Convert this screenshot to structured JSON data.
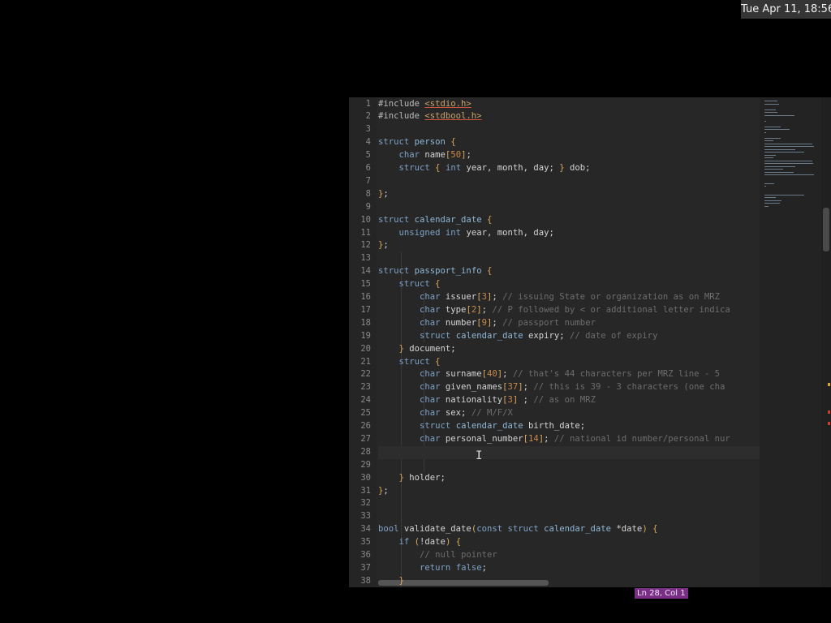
{
  "topbar": {
    "clock": "Tue Apr 11, 18:56"
  },
  "status": {
    "cursor_position": "Ln 28, Col 1"
  },
  "editor": {
    "current_line": 28,
    "lines": [
      {
        "n": "1",
        "t": [
          [
            "pp",
            "#include "
          ],
          [
            "inc",
            "<stdio.h>"
          ]
        ]
      },
      {
        "n": "2",
        "t": [
          [
            "pp",
            "#include "
          ],
          [
            "inc",
            "<stdbool.h>"
          ]
        ]
      },
      {
        "n": "3",
        "t": []
      },
      {
        "n": "4",
        "t": [
          [
            "kw",
            "struct "
          ],
          [
            "nm",
            "person "
          ],
          [
            "br",
            "{"
          ]
        ]
      },
      {
        "n": "5",
        "t": [
          [
            "bv",
            "    "
          ],
          [
            "ty",
            "char "
          ],
          [
            "bv",
            "name"
          ],
          [
            "br",
            "["
          ],
          [
            "num",
            "50"
          ],
          [
            "br",
            "]"
          ],
          [
            "bv",
            ";"
          ]
        ]
      },
      {
        "n": "6",
        "t": [
          [
            "bv",
            "    "
          ],
          [
            "kw",
            "struct "
          ],
          [
            "br",
            "{ "
          ],
          [
            "ty",
            "int "
          ],
          [
            "bv",
            "year, month, day; "
          ],
          [
            "br",
            "} "
          ],
          [
            "bv",
            "dob;"
          ]
        ]
      },
      {
        "n": "7",
        "t": []
      },
      {
        "n": "8",
        "t": [
          [
            "br",
            "}"
          ],
          [
            "bv",
            ";"
          ]
        ]
      },
      {
        "n": "9",
        "t": []
      },
      {
        "n": "10",
        "t": [
          [
            "kw",
            "struct "
          ],
          [
            "nm",
            "calendar_date "
          ],
          [
            "br",
            "{"
          ]
        ]
      },
      {
        "n": "11",
        "t": [
          [
            "bv",
            "    "
          ],
          [
            "ty",
            "unsigned int "
          ],
          [
            "bv",
            "year, month, day;"
          ]
        ]
      },
      {
        "n": "12",
        "t": [
          [
            "br",
            "}"
          ],
          [
            "bv",
            ";"
          ]
        ]
      },
      {
        "n": "13",
        "t": []
      },
      {
        "n": "14",
        "t": [
          [
            "kw",
            "struct "
          ],
          [
            "nm",
            "passport_info "
          ],
          [
            "br",
            "{"
          ]
        ]
      },
      {
        "n": "15",
        "t": [
          [
            "bv",
            "    "
          ],
          [
            "kw",
            "struct "
          ],
          [
            "br",
            "{"
          ]
        ]
      },
      {
        "n": "16",
        "t": [
          [
            "bv",
            "        "
          ],
          [
            "ty",
            "char "
          ],
          [
            "bv",
            "issuer"
          ],
          [
            "br",
            "["
          ],
          [
            "num",
            "3"
          ],
          [
            "br",
            "]"
          ],
          [
            "bv",
            "; "
          ],
          [
            "cm",
            "// issuing State or organization as on MRZ"
          ]
        ]
      },
      {
        "n": "17",
        "t": [
          [
            "bv",
            "        "
          ],
          [
            "ty",
            "char "
          ],
          [
            "bv",
            "type"
          ],
          [
            "br",
            "["
          ],
          [
            "num",
            "2"
          ],
          [
            "br",
            "]"
          ],
          [
            "bv",
            "; "
          ],
          [
            "cm",
            "// P followed by < or additional letter indica"
          ]
        ]
      },
      {
        "n": "18",
        "t": [
          [
            "bv",
            "        "
          ],
          [
            "ty",
            "char "
          ],
          [
            "bv",
            "number"
          ],
          [
            "br",
            "["
          ],
          [
            "num",
            "9"
          ],
          [
            "br",
            "]"
          ],
          [
            "bv",
            "; "
          ],
          [
            "cm",
            "// passport number"
          ]
        ]
      },
      {
        "n": "19",
        "t": [
          [
            "bv",
            "        "
          ],
          [
            "kw",
            "struct "
          ],
          [
            "nm",
            "calendar_date "
          ],
          [
            "bv",
            "expiry; "
          ],
          [
            "cm",
            "// date of expiry"
          ]
        ]
      },
      {
        "n": "20",
        "t": [
          [
            "bv",
            "    "
          ],
          [
            "br",
            "} "
          ],
          [
            "bv",
            "document;"
          ]
        ]
      },
      {
        "n": "21",
        "t": [
          [
            "bv",
            "    "
          ],
          [
            "kw",
            "struct "
          ],
          [
            "br",
            "{"
          ]
        ]
      },
      {
        "n": "22",
        "t": [
          [
            "bv",
            "        "
          ],
          [
            "ty",
            "char "
          ],
          [
            "bv",
            "surname"
          ],
          [
            "br",
            "["
          ],
          [
            "num",
            "40"
          ],
          [
            "br",
            "]"
          ],
          [
            "bv",
            "; "
          ],
          [
            "cm",
            "// that's 44 characters per MRZ line - 5"
          ]
        ]
      },
      {
        "n": "23",
        "t": [
          [
            "bv",
            "        "
          ],
          [
            "ty",
            "char "
          ],
          [
            "bv",
            "given_names"
          ],
          [
            "br",
            "["
          ],
          [
            "num",
            "37"
          ],
          [
            "br",
            "]"
          ],
          [
            "bv",
            "; "
          ],
          [
            "cm",
            "// this is 39 - 3 characters (one cha"
          ]
        ]
      },
      {
        "n": "24",
        "t": [
          [
            "bv",
            "        "
          ],
          [
            "ty",
            "char "
          ],
          [
            "bv",
            "nationality"
          ],
          [
            "br",
            "["
          ],
          [
            "num",
            "3"
          ],
          [
            "br",
            "]"
          ],
          [
            "bv",
            " ; "
          ],
          [
            "cm",
            "// as on MRZ"
          ]
        ]
      },
      {
        "n": "25",
        "t": [
          [
            "bv",
            "        "
          ],
          [
            "ty",
            "char "
          ],
          [
            "bv",
            "sex; "
          ],
          [
            "cm",
            "// M/F/X"
          ]
        ]
      },
      {
        "n": "26",
        "t": [
          [
            "bv",
            "        "
          ],
          [
            "kw",
            "struct "
          ],
          [
            "nm",
            "calendar_date "
          ],
          [
            "bv",
            "birth_date;"
          ]
        ]
      },
      {
        "n": "27",
        "t": [
          [
            "bv",
            "        "
          ],
          [
            "ty",
            "char "
          ],
          [
            "bv",
            "personal_number"
          ],
          [
            "br",
            "["
          ],
          [
            "num",
            "14"
          ],
          [
            "br",
            "]"
          ],
          [
            "bv",
            "; "
          ],
          [
            "cm",
            "// national id number/personal nur"
          ]
        ]
      },
      {
        "n": "28",
        "t": []
      },
      {
        "n": "29",
        "t": []
      },
      {
        "n": "30",
        "t": [
          [
            "bv",
            "    "
          ],
          [
            "br",
            "} "
          ],
          [
            "bv",
            "holder;"
          ]
        ]
      },
      {
        "n": "31",
        "t": [
          [
            "br",
            "}"
          ],
          [
            "bv",
            ";"
          ]
        ]
      },
      {
        "n": "32",
        "t": []
      },
      {
        "n": "33",
        "t": []
      },
      {
        "n": "34",
        "t": [
          [
            "ty",
            "bool "
          ],
          [
            "bv",
            "validate_date"
          ],
          [
            "br",
            "("
          ],
          [
            "kw",
            "const struct "
          ],
          [
            "nm",
            "calendar_date "
          ],
          [
            "bv",
            "*date"
          ],
          [
            "br",
            ") {"
          ]
        ]
      },
      {
        "n": "35",
        "t": [
          [
            "bv",
            "    "
          ],
          [
            "kw",
            "if "
          ],
          [
            "br",
            "("
          ],
          [
            "bv",
            "!date"
          ],
          [
            "br",
            ") {"
          ]
        ]
      },
      {
        "n": "36",
        "t": [
          [
            "bv",
            "        "
          ],
          [
            "cm",
            "// null pointer"
          ]
        ]
      },
      {
        "n": "37",
        "t": [
          [
            "bv",
            "        "
          ],
          [
            "kw",
            "return "
          ],
          [
            "kw",
            "false"
          ],
          [
            "bv",
            ";"
          ]
        ]
      },
      {
        "n": "38",
        "t": [
          [
            "bv",
            "    "
          ],
          [
            "br",
            "}"
          ]
        ]
      }
    ]
  },
  "colors": {
    "status_bg": "#7a2f86",
    "editor_bg": "#272727",
    "error_mark": "#d23a2a",
    "warning_mark": "#d9a22a"
  }
}
